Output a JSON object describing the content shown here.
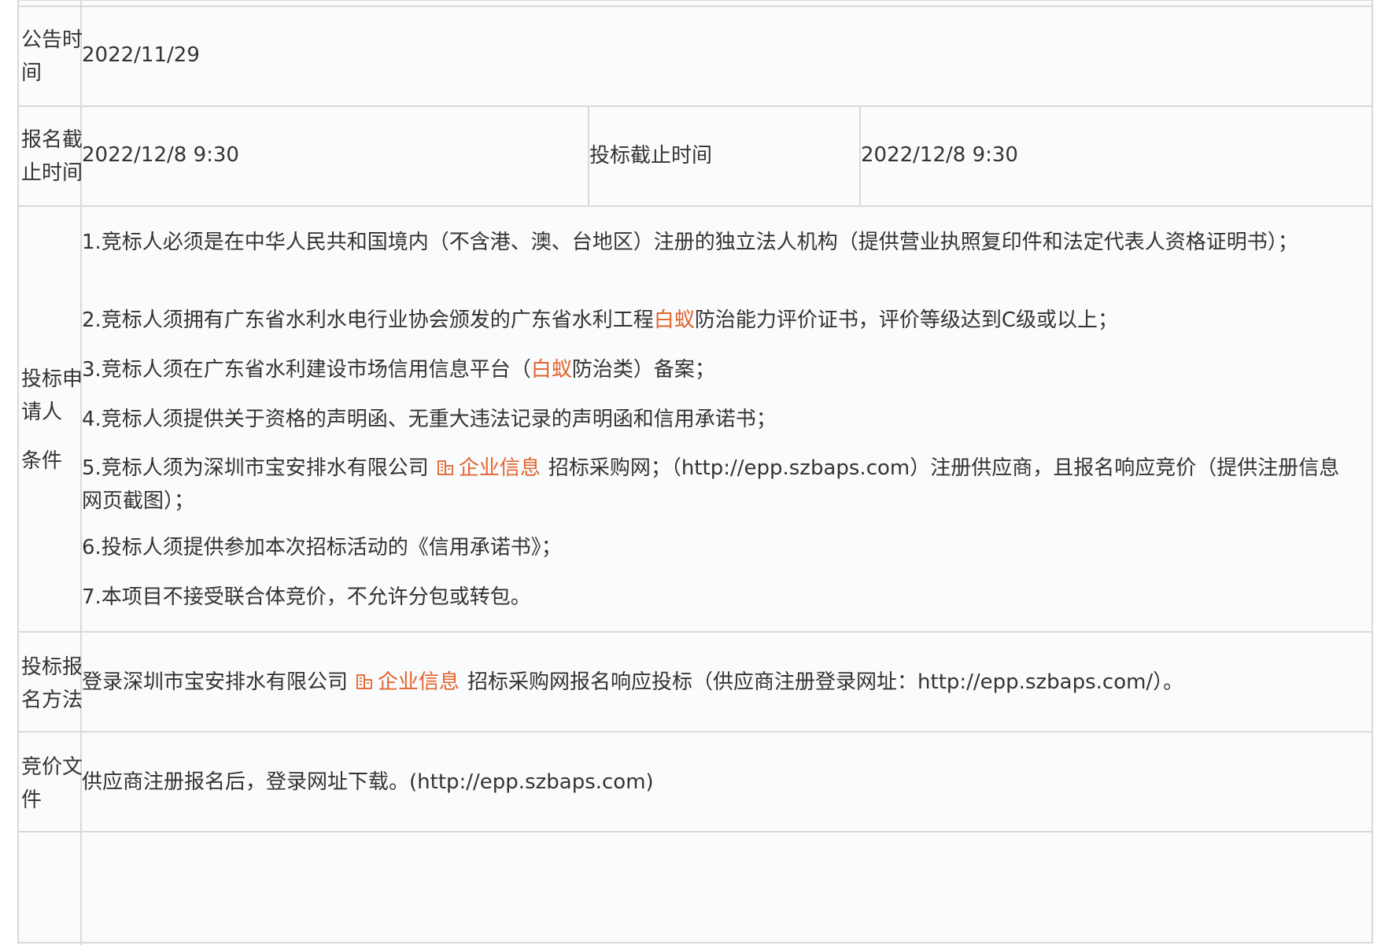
{
  "rows": {
    "announce": {
      "label_lines": [
        "公告时",
        "间"
      ],
      "value": "2022/11/29"
    },
    "deadline": {
      "label_lines": [
        "报名截",
        "止时间"
      ],
      "value": "2022/12/8 9:30",
      "bid_label": "投标截止时间",
      "bid_value": "2022/12/8 9:30"
    },
    "conditions": {
      "label_lines": [
        "投标申",
        "请人",
        "条件"
      ],
      "items": [
        {
          "text": "1.竞标人必须是在中华人民共和国境内（不含港、澳、台地区）注册的独立法人机构（提供营业执照复印件和法定代表人资格证明书）；"
        },
        {
          "pre": "2.竞标人须拥有广东省水利水电行业协会颁发的广东省水利工程",
          "hl": "白蚁",
          "post": "防治能力评价证书，评价等级达到C级或以上；"
        },
        {
          "pre": "3.竞标人须在广东省水利建设市场信用信息平台（",
          "hl": "白蚁",
          "post": "防治类）备案；"
        },
        {
          "text": "4.竞标人须提供关于资格的声明函、无重大违法记录的声明函和信用承诺书；"
        },
        {
          "pre": "5.竞标人须为深圳市宝安排水有限公司",
          "ent": "企业信息",
          "post": "招标采购网；（http://epp.szbaps.com）注册供应商，且报名响应竞价（提供注册信息网页截图）；"
        },
        {
          "text": "6.投标人须提供参加本次招标活动的《信用承诺书》；"
        },
        {
          "text": "7.本项目不接受联合体竞价，不允许分包或转包。"
        }
      ]
    },
    "method": {
      "label_lines": [
        "投标报",
        "名方法"
      ],
      "pre": "登录深圳市宝安排水有限公司",
      "ent": "企业信息",
      "post": "招标采购网报名响应投标（供应商注册登录网址：http://epp.szbaps.com/）。"
    },
    "docs": {
      "label_lines": [
        "竞价文",
        "件"
      ],
      "value": "供应商注册报名后，登录网址下载。(http://epp.szbaps.com)"
    }
  },
  "colors": {
    "border": "#d9d9d9",
    "cell_bg": "#f9fbfd",
    "text": "#333333",
    "highlight": "#e4632b"
  },
  "icons": {
    "enterprise": "building-icon"
  }
}
